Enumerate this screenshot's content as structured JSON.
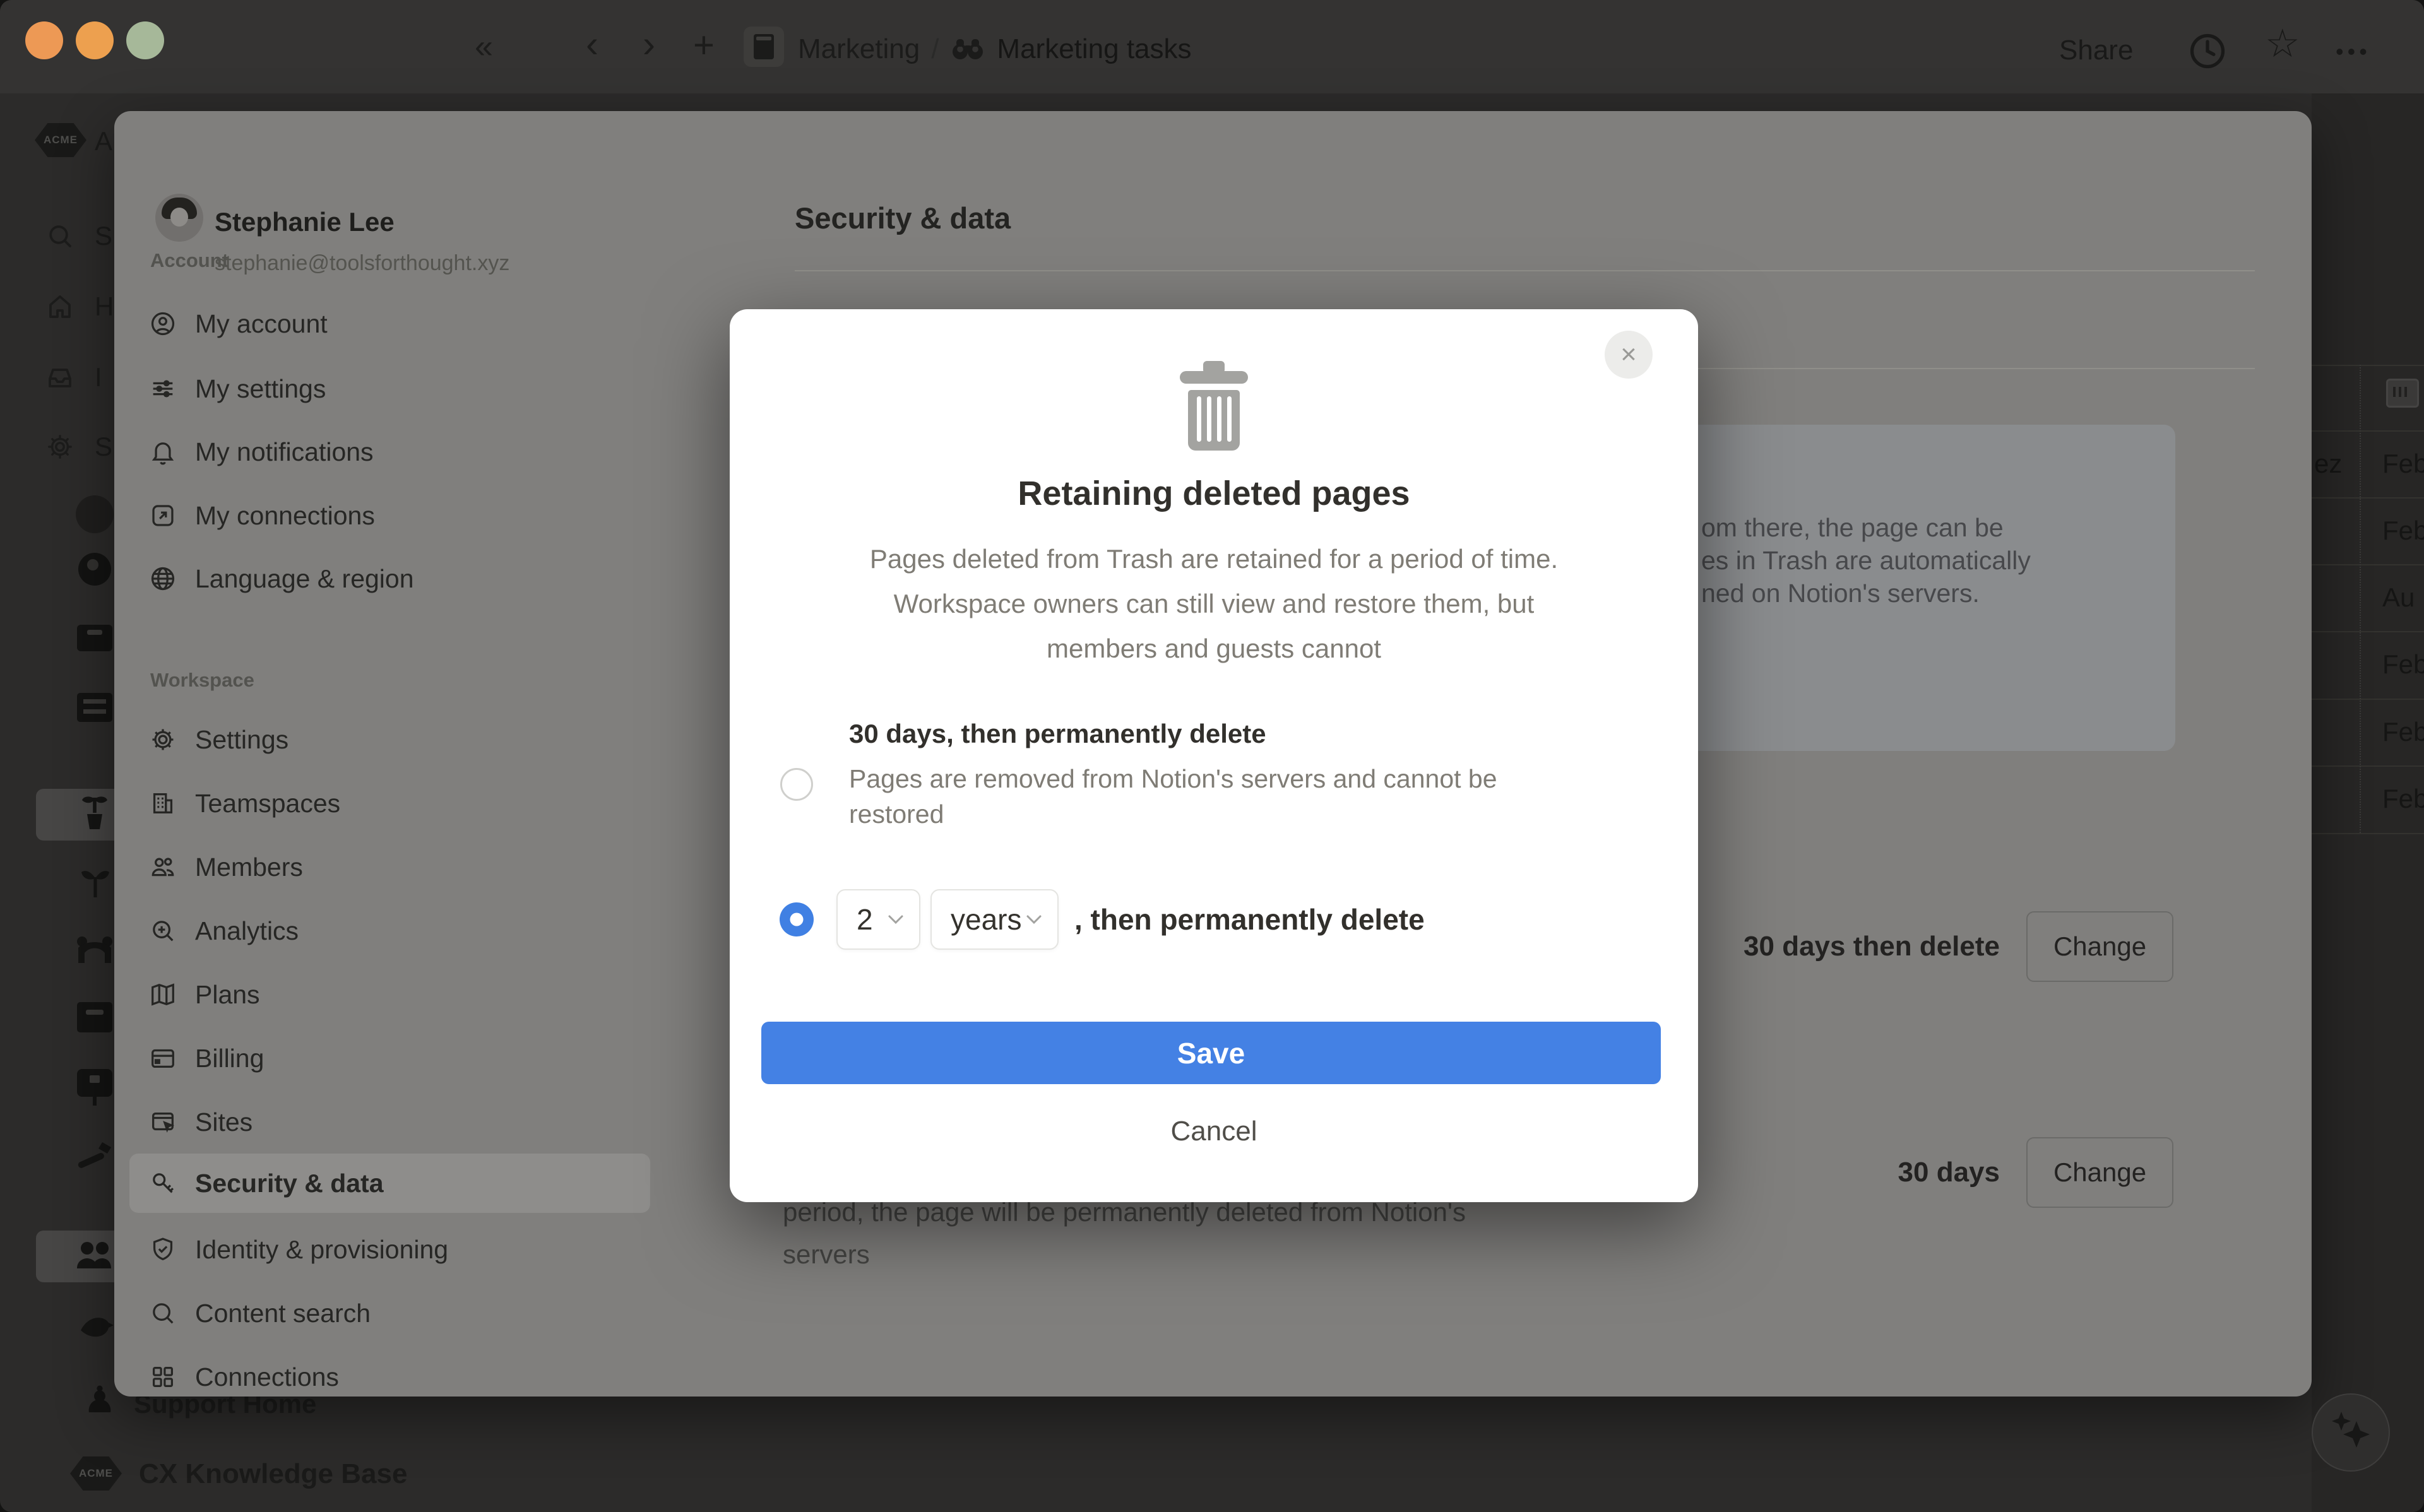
{
  "topbar": {
    "collapse_icon": "«",
    "back_icon": "‹",
    "forward_icon": "›",
    "new_page_icon": "+",
    "breadcrumb": {
      "parent": "Marketing",
      "separator": "/",
      "current": "Marketing tasks"
    },
    "share_label": "Share",
    "more_icon": "•••",
    "star_icon": "☆"
  },
  "app_sidebar": {
    "workspace_badge": "ACME",
    "clipped_letters": [
      "A",
      "S",
      "H",
      "I",
      "S"
    ],
    "pawn_icon": "♟",
    "support_home_label": "Support Home",
    "knowledge_base_label": "CX Knowledge Base"
  },
  "settings_panel": {
    "account_header": "Account",
    "profile": {
      "name": "Stephanie Lee",
      "email": "stephanie@toolsforthought.xyz"
    },
    "account_items": [
      {
        "label": "My account"
      },
      {
        "label": "My settings"
      },
      {
        "label": "My notifications"
      },
      {
        "label": "My connections"
      },
      {
        "label": "Language & region"
      }
    ],
    "workspace_header": "Workspace",
    "workspace_items": [
      {
        "label": "Settings"
      },
      {
        "label": "Teamspaces"
      },
      {
        "label": "Members"
      },
      {
        "label": "Analytics"
      },
      {
        "label": "Plans"
      },
      {
        "label": "Billing"
      },
      {
        "label": "Sites"
      },
      {
        "label": "Security & data",
        "selected": true
      },
      {
        "label": "Identity & provisioning"
      },
      {
        "label": "Content search"
      },
      {
        "label": "Connections"
      }
    ],
    "main": {
      "title": "Security & data",
      "info_box_fragments": [
        "om there, the page can be",
        "es in Trash are automatically",
        "ned on Notion's servers."
      ],
      "retention_rows": [
        {
          "value": "30 days then delete",
          "action_label": "Change"
        },
        {
          "value": "30 days",
          "action_label": "Change"
        }
      ],
      "footer_fragments": [
        "period, the page will be permanently deleted from Notion's",
        "servers"
      ]
    }
  },
  "background_table": {
    "rows": [
      {
        "left": "ez",
        "right": "Feb"
      },
      {
        "left": "",
        "right": "Feb"
      },
      {
        "left": "",
        "right": "Au"
      },
      {
        "left": "",
        "right": "Feb"
      },
      {
        "left": "",
        "right": "Feb"
      },
      {
        "left": "",
        "right": "Feb"
      }
    ]
  },
  "modal": {
    "close_icon": "×",
    "title": "Retaining deleted pages",
    "description_lines": [
      "Pages deleted from Trash are retained for a period of time.",
      "Workspace owners can still view and restore them, but",
      "members and guests cannot"
    ],
    "option_30_days": {
      "label": "30 days, then permanently delete",
      "sublabel_lines": [
        "Pages are removed from Notion's servers and cannot be",
        "restored"
      ],
      "selected": false
    },
    "option_custom": {
      "number_value": "2",
      "unit_value": "years",
      "suffix": ", then permanently delete",
      "selected": true
    },
    "save_label": "Save",
    "cancel_label": "Cancel"
  },
  "colors": {
    "accent_blue": "#4481e4",
    "modal_bg": "#ffffff",
    "panel_dimmed_bg": "#807f7d",
    "window_bg": "#2c2b2a",
    "traffic_light_1": "#ed9955",
    "traffic_light_2": "#eda04f",
    "traffic_light_3": "#a6b899"
  }
}
